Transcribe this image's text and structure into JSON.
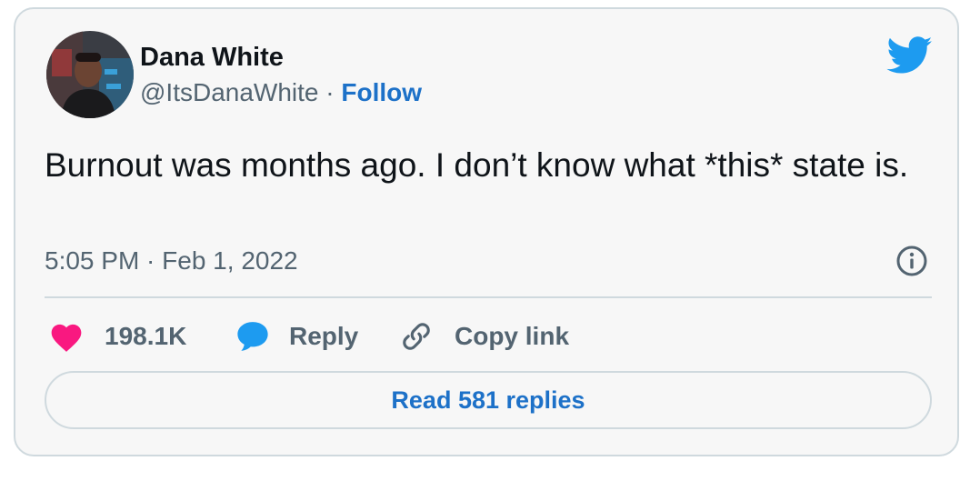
{
  "author": {
    "name": "Dana White",
    "handle": "@ItsDanaWhite",
    "separator": " · ",
    "follow_label": "Follow"
  },
  "tweet": {
    "text": "Burnout was months ago. I don’t know what *this* state is.",
    "timestamp": "5:05 PM · Feb 1, 2022"
  },
  "actions": {
    "like_count": "198.1K",
    "reply_label": "Reply",
    "copy_link_label": "Copy link"
  },
  "read_replies_label": "Read 581 replies",
  "colors": {
    "twitter_blue": "#1d9bf0",
    "link_blue": "#1d71c8",
    "heart_pink": "#f91880",
    "muted_text": "#536471",
    "border": "#cfd9de"
  },
  "icons": [
    "twitter-bird-icon",
    "info-icon",
    "heart-icon",
    "reply-bubble-icon",
    "link-icon"
  ]
}
